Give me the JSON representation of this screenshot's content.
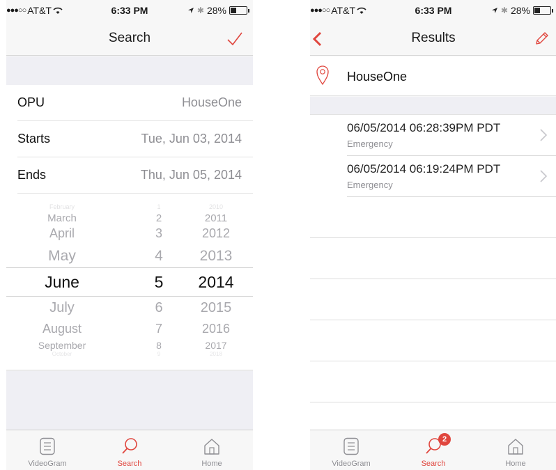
{
  "left": {
    "status": {
      "carrier": "AT&T",
      "time": "6:33 PM",
      "battery": "28%"
    },
    "nav": {
      "title": "Search"
    },
    "fields": [
      {
        "label": "OPU",
        "value": "HouseOne"
      },
      {
        "label": "Starts",
        "value": "Tue, Jun 03, 2014"
      },
      {
        "label": "Ends",
        "value": "Thu, Jun 05, 2014"
      }
    ],
    "picker": {
      "months": [
        "February",
        "March",
        "April",
        "May",
        "June",
        "July",
        "August",
        "September",
        "October"
      ],
      "days": [
        "1",
        "2",
        "3",
        "4",
        "5",
        "6",
        "7",
        "8",
        "9"
      ],
      "years": [
        "2010",
        "2011",
        "2012",
        "2013",
        "2014",
        "2015",
        "2016",
        "2017",
        "2018"
      ],
      "selected": {
        "month": "June",
        "day": "5",
        "year": "2014"
      }
    },
    "tabs": [
      {
        "label": "VideoGram",
        "icon": "videogram-icon"
      },
      {
        "label": "Search",
        "icon": "search-icon"
      },
      {
        "label": "Home",
        "icon": "home-icon"
      }
    ]
  },
  "right": {
    "status": {
      "carrier": "AT&T",
      "time": "6:33 PM",
      "battery": "28%"
    },
    "nav": {
      "title": "Results"
    },
    "location": {
      "name": "HouseOne",
      "icon": "location-pin-icon"
    },
    "results": [
      {
        "timestamp": "06/05/2014 06:28:39PM PDT",
        "type": "Emergency"
      },
      {
        "timestamp": "06/05/2014 06:19:24PM PDT",
        "type": "Emergency"
      }
    ],
    "tabs": [
      {
        "label": "VideoGram",
        "icon": "videogram-icon"
      },
      {
        "label": "Search",
        "icon": "search-icon",
        "badge": "2"
      },
      {
        "label": "Home",
        "icon": "home-icon"
      }
    ]
  },
  "colors": {
    "accent": "#e0463e",
    "muted": "#8e8e93",
    "separator": "#e2e2e2"
  }
}
